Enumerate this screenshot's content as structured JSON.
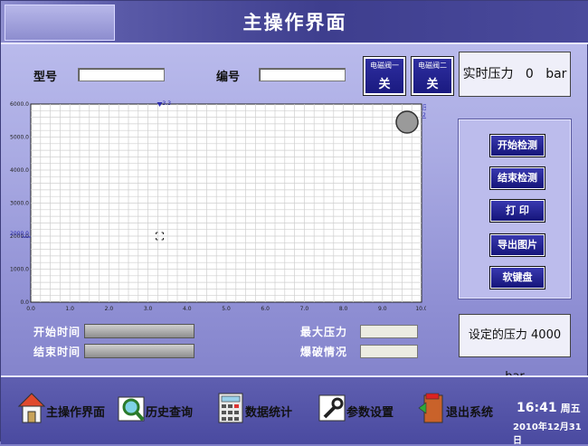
{
  "header": {
    "title": "主操作界面"
  },
  "form": {
    "model_label": "型号",
    "model_value": "",
    "serial_label": "编号",
    "serial_value": ""
  },
  "valves": [
    {
      "name": "电磁阀一",
      "state": "关"
    },
    {
      "name": "电磁阀二",
      "state": "关"
    }
  ],
  "realtime_pressure": {
    "label": "实时压力",
    "value": "0",
    "unit": "bar"
  },
  "chart_data": {
    "type": "line",
    "x_range": [
      0,
      10
    ],
    "y_range": [
      0,
      6000
    ],
    "x_ticks": [
      "0.0",
      "1.0",
      "2.0",
      "3.0",
      "4.0",
      "5.0",
      "6.0",
      "7.0",
      "8.0",
      "9.0",
      "10.0"
    ],
    "y_ticks": [
      "0.0",
      "1000.0",
      "2000.0",
      "3000.0",
      "4000.0",
      "5000.0",
      "6000.0"
    ],
    "grid": true,
    "series": [],
    "markers": {
      "cursor_x_label": "3.3",
      "y_marker_label": "2000.0",
      "legend_label": "压力",
      "legend_value": "2222"
    }
  },
  "buttons": {
    "start": "开始检测",
    "stop": "结束检测",
    "print": "打 印",
    "export": "导出图片",
    "keyboard": "软键盘"
  },
  "set_pressure": {
    "label": "设定的压力",
    "value": "4000",
    "unit": "bar"
  },
  "status": {
    "start_time_label": "开始时间",
    "end_time_label": "结束时间",
    "max_pressure_label": "最大压力",
    "burst_label": "爆破情况"
  },
  "nav": [
    {
      "label": "主操作界面"
    },
    {
      "label": "历史查询"
    },
    {
      "label": "数据统计"
    },
    {
      "label": "参数设置"
    },
    {
      "label": "退出系统"
    }
  ],
  "clock": {
    "time": "16:41",
    "weekday": "周五",
    "date": "2010年12月31日"
  },
  "colors": {
    "accent": "#1a1a80",
    "grid": "#cfcfcf"
  }
}
